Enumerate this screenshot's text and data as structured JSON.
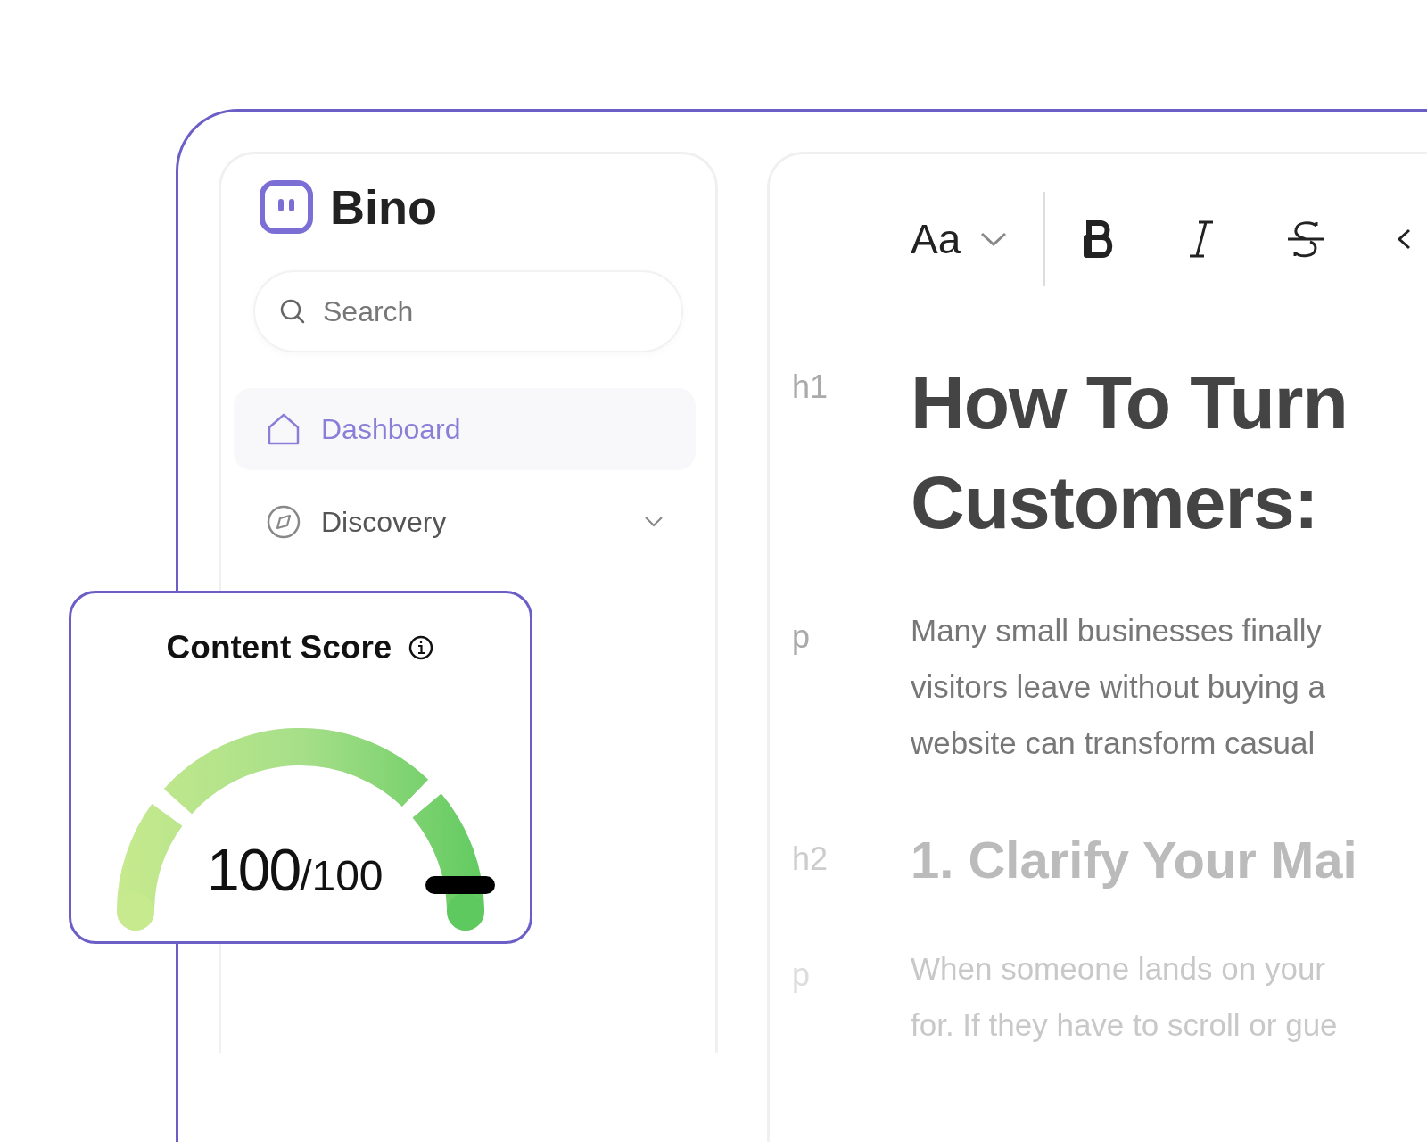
{
  "app": {
    "name": "Bino"
  },
  "sidebar": {
    "search": {
      "placeholder": "Search"
    },
    "items": [
      {
        "label": "Dashboard",
        "selected": true,
        "expandable": false
      },
      {
        "label": "Discovery",
        "selected": false,
        "expandable": true
      }
    ]
  },
  "toolbar": {
    "font_menu": "Aa"
  },
  "document": {
    "blocks": [
      {
        "tag": "h1",
        "kind": "h1",
        "lines": [
          "How To Turn",
          "Customers:"
        ]
      },
      {
        "tag": "p",
        "kind": "p",
        "lines": [
          "Many small businesses finally",
          "visitors leave without buying a",
          "website can transform casual"
        ]
      },
      {
        "tag": "h2",
        "kind": "h2",
        "lines": [
          "1. Clarify Your Mai"
        ]
      },
      {
        "tag": "p",
        "kind": "p-faint",
        "lines": [
          "When someone lands on your",
          "for. If they have to scroll or gue"
        ]
      }
    ]
  },
  "content_score": {
    "title": "Content Score",
    "score": "100",
    "max": "/100",
    "level": 1
  }
}
